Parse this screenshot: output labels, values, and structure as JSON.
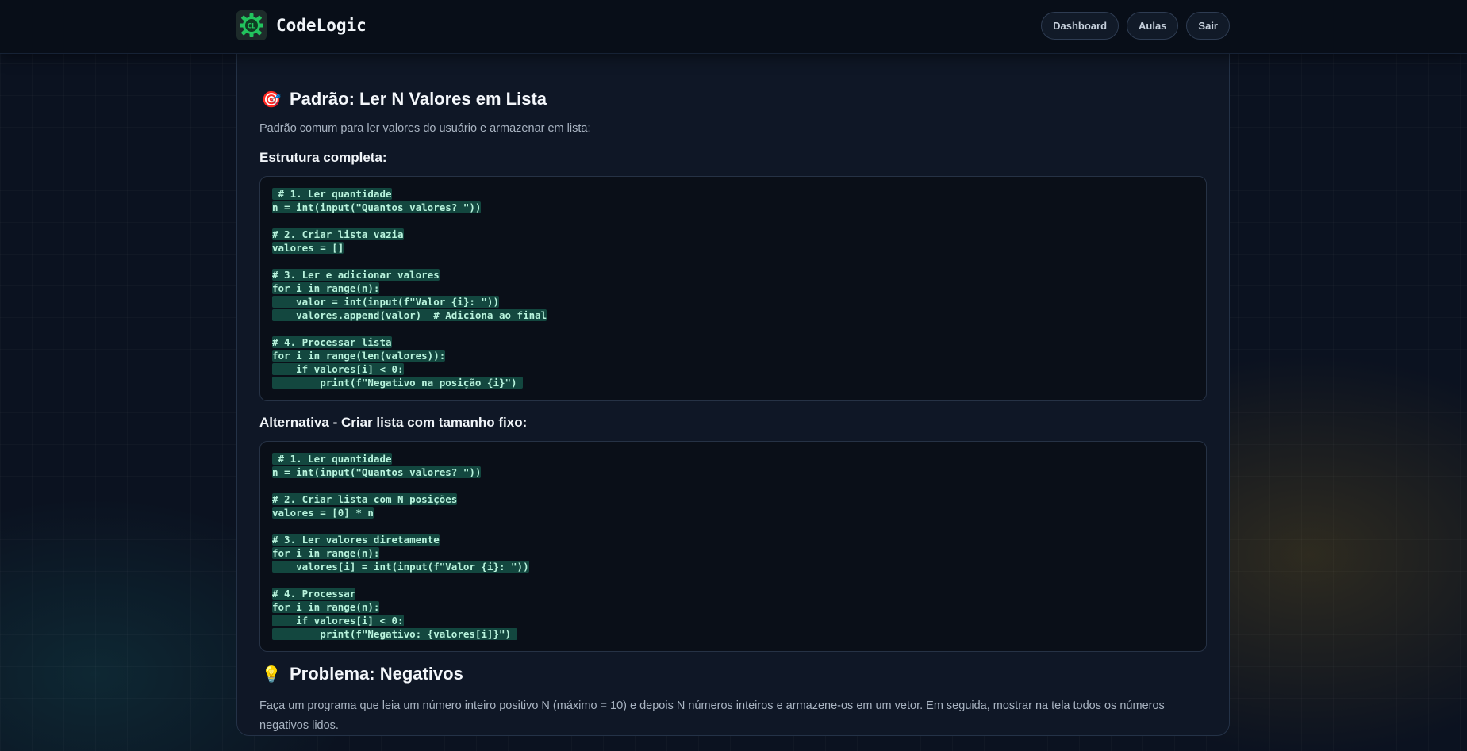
{
  "header": {
    "brand": "CodeLogic",
    "logo_text": "CL",
    "nav": [
      "Dashboard",
      "Aulas",
      "Sair"
    ]
  },
  "section1": {
    "icon": "target-icon",
    "title": "Padrão: Ler N Valores em Lista",
    "description": "Padrão comum para ler valores do usuário e armazenar em lista:",
    "sub1": "Estrutura completa:",
    "code1": " # 1. Ler quantidade\nn = int(input(\"Quantos valores? \"))\n\n# 2. Criar lista vazia\nvalores = []\n\n# 3. Ler e adicionar valores\nfor i in range(n):\n    valor = int(input(f\"Valor {i}: \"))\n    valores.append(valor)  # Adiciona ao final\n\n# 4. Processar lista\nfor i in range(len(valores)):\n    if valores[i] < 0:\n        print(f\"Negativo na posição {i}\") ",
    "sub2": "Alternativa - Criar lista com tamanho fixo:",
    "code2": " # 1. Ler quantidade\nn = int(input(\"Quantos valores? \"))\n\n# 2. Criar lista com N posições\nvalores = [0] * n\n\n# 3. Ler valores diretamente\nfor i in range(n):\n    valores[i] = int(input(f\"Valor {i}: \"))\n\n# 4. Processar\nfor i in range(n):\n    if valores[i] < 0:\n        print(f\"Negativo: {valores[i]}\") "
  },
  "section2": {
    "icon": "lightbulb-icon",
    "title": "Problema: Negativos",
    "description": "Faça um programa que leia um número inteiro positivo N (máximo = 10) e depois N números inteiros e armazene-os em um vetor. Em seguida, mostrar na tela todos os números negativos lidos."
  },
  "colors": {
    "accent": "#22c55e",
    "code_highlight": "#13473f",
    "code_text": "#b9f3dd"
  }
}
